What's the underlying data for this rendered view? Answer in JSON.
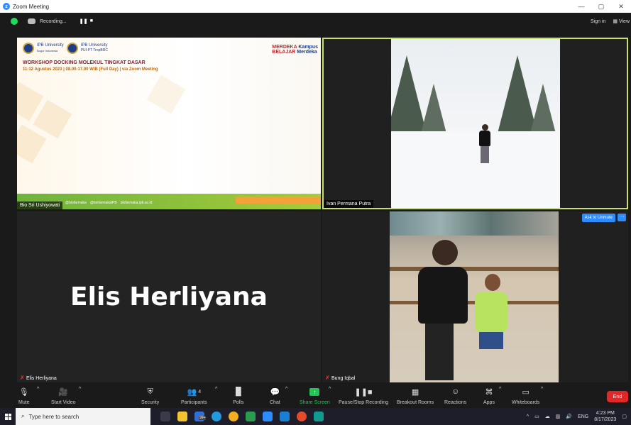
{
  "window": {
    "title": "Zoom Meeting",
    "minimize": "—",
    "maximize": "▢",
    "close": "✕"
  },
  "topbar": {
    "recording_label": "Recording...",
    "pause_icon": "pause-icon",
    "stop_icon": "stop-icon",
    "sign_in": "Sign in",
    "view": "View"
  },
  "tiles": [
    {
      "name": "Bio Sri Ushiyowati"
    },
    {
      "name": "Ivan Permana Putra"
    },
    {
      "name": "Elis Herliyana",
      "big_name": "Elis Herliyana"
    },
    {
      "name": "Bung Iqbal",
      "unmute_button": "Ask to Unmute",
      "more": "···"
    }
  ],
  "slide": {
    "ipb1": "IPB University",
    "ipb1_sub": "Bogor Indonesia",
    "ipb2": "IPB University",
    "ipb2_sub": "PUI-PT TropBRC",
    "merdeka1": "MERDEKA",
    "merdeka2": "BELAJAR",
    "kampus1": "Kampus",
    "kampus2": "Merdeka",
    "title": "WORKSHOP DOCKING MOLEKUL TINGKAT DASAR",
    "subtitle": "11-12 Agustus 2023 | 08.00-17.00 WIB (Full Day) | via Zoom Meeting",
    "social1": "@biofarmaka",
    "social2": "@biofarmakaIPB",
    "social3": "biofarmaka.ipb.ac.id"
  },
  "toolbar": {
    "mute": "Mute",
    "start_video": "Start Video",
    "security": "Security",
    "participants": "Participants",
    "participants_count": "4",
    "polls": "Polls",
    "chat": "Chat",
    "share_screen": "Share Screen",
    "pause_stop": "Pause/Stop Recording",
    "breakout": "Breakout Rooms",
    "reactions": "Reactions",
    "apps": "Apps",
    "whiteboards": "Whiteboards",
    "end": "End"
  },
  "taskbar": {
    "search_placeholder": "Type here to search",
    "badge": "99+",
    "lang": "ENG",
    "time": "4:23 PM",
    "date": "8/17/2023"
  },
  "colors": {
    "accent": "#2d8cff",
    "active_speaker": "#c7e26a",
    "end_red": "#e02828",
    "share_green": "#23c355"
  }
}
